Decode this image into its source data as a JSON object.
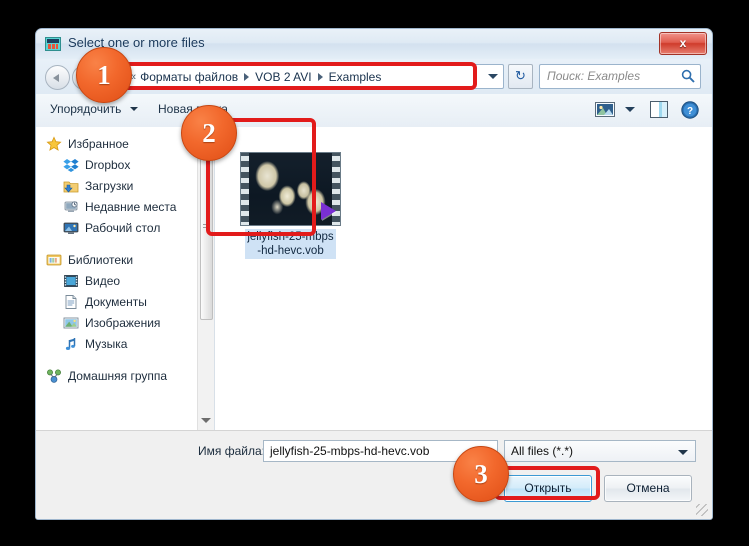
{
  "window": {
    "title": "Select one or more files",
    "close_label": "x",
    "icon": "app-icon"
  },
  "address_bar": {
    "back_icon": "back-arrow-icon",
    "forward_icon": "forward-arrow-icon",
    "overflow_chevron": "«",
    "crumbs": [
      "Форматы файлов",
      "VOB 2 AVI",
      "Examples"
    ],
    "dropdown_icon": "chevron-down-icon",
    "refresh_icon": "↻"
  },
  "search": {
    "placeholder": "Поиск: Examples",
    "icon": "search-icon"
  },
  "toolbar": {
    "organize_label": "Упорядочить",
    "new_folder_label": "Новая папка",
    "view_icon": "view-options-icon",
    "preview_pane_icon": "preview-pane-icon",
    "help_icon": "help-icon"
  },
  "sidebar": {
    "items": [
      {
        "label": "Избранное",
        "icon": "star-icon",
        "level": "root"
      },
      {
        "label": "Dropbox",
        "icon": "dropbox-icon",
        "level": "child"
      },
      {
        "label": "Загрузки",
        "icon": "downloads-icon",
        "level": "child"
      },
      {
        "label": "Недавние места",
        "icon": "recent-icon",
        "level": "child"
      },
      {
        "label": "Рабочий стол",
        "icon": "desktop-icon",
        "level": "child"
      },
      {
        "label": "Библиотеки",
        "icon": "libraries-icon",
        "level": "root"
      },
      {
        "label": "Видео",
        "icon": "video-icon",
        "level": "child"
      },
      {
        "label": "Документы",
        "icon": "documents-icon",
        "level": "child"
      },
      {
        "label": "Изображения",
        "icon": "pictures-icon",
        "level": "child"
      },
      {
        "label": "Музыка",
        "icon": "music-icon",
        "level": "child"
      },
      {
        "label": "Домашняя группа",
        "icon": "homegroup-icon",
        "level": "root"
      }
    ],
    "scrollbar": {
      "down_arrow_icon": "scroll-down-icon"
    }
  },
  "file_list": {
    "items": [
      {
        "name": "jellyfish-25-mbps-hd-hevc.vob",
        "line1": "jellyfish-25-mbps",
        "line2": "-hd-hevc.vob",
        "thumbnail": "video-thumbnail-jellyfish",
        "selected": true
      }
    ]
  },
  "footer": {
    "file_name_label": "Имя файла:",
    "file_name_value": "jellyfish-25-mbps-hd-hevc.vob",
    "filter_value": "All files (*.*)",
    "filter_caret_icon": "chevron-down-icon",
    "open_label": "Открыть",
    "cancel_label": "Отмена",
    "resize_grip_icon": "resize-grip-icon"
  },
  "annotations": {
    "badges": [
      {
        "number": "1"
      },
      {
        "number": "2"
      },
      {
        "number": "3"
      }
    ],
    "highlight_color": "#e21b1b",
    "badge_color": "#f2682c"
  }
}
